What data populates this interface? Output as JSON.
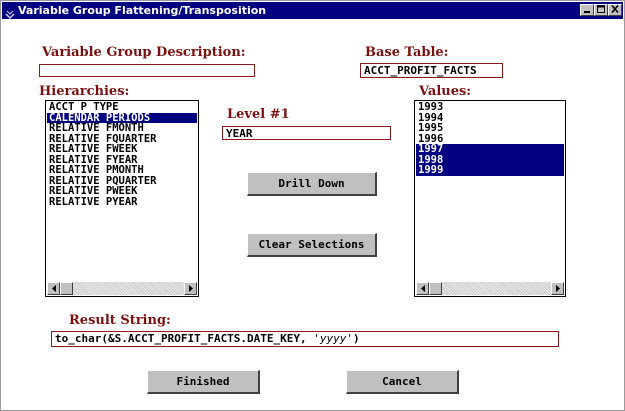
{
  "window": {
    "title": "Variable Group Flattening/Transposition",
    "controls": {
      "minimize": "_",
      "maximize": "□",
      "close": "×"
    }
  },
  "variable_group_description": {
    "label": "Variable Group Description:",
    "value": ""
  },
  "base_table": {
    "label": "Base Table:",
    "value": "ACCT_PROFIT_FACTS"
  },
  "hierarchies": {
    "label": "Hierarchies:",
    "items": [
      {
        "text": "ACCT P TYPE",
        "selected": false
      },
      {
        "text": "CALENDAR PERIODS",
        "selected": true
      },
      {
        "text": "RELATIVE FMONTH",
        "selected": false
      },
      {
        "text": "RELATIVE FQUARTER",
        "selected": false
      },
      {
        "text": "RELATIVE FWEEK",
        "selected": false
      },
      {
        "text": "RELATIVE FYEAR",
        "selected": false
      },
      {
        "text": "RELATIVE PMONTH",
        "selected": false
      },
      {
        "text": "RELATIVE PQUARTER",
        "selected": false
      },
      {
        "text": "RELATIVE PWEEK",
        "selected": false
      },
      {
        "text": "RELATIVE PYEAR",
        "selected": false
      }
    ]
  },
  "level": {
    "label": "Level #1",
    "value": "YEAR"
  },
  "buttons": {
    "drill_down": "Drill Down",
    "clear_selections": "Clear Selections",
    "finished": "Finished",
    "cancel": "Cancel"
  },
  "values": {
    "label": "Values:",
    "items": [
      {
        "text": "1993",
        "selected": false
      },
      {
        "text": "1994",
        "selected": false
      },
      {
        "text": "1995",
        "selected": false
      },
      {
        "text": "1996",
        "selected": false
      },
      {
        "text": "1997",
        "selected": true
      },
      {
        "text": "1998",
        "selected": true
      },
      {
        "text": "1999",
        "selected": true
      }
    ]
  },
  "result_string": {
    "label": "Result String:",
    "prefix": "to_char(&S.ACCT_PROFIT_FACTS.DATE_KEY, ",
    "quoted": "'yyyy'",
    "suffix": ")"
  },
  "colors": {
    "title_bar": "#000080",
    "label_text": "#7a1010",
    "field_border": "#8b1a1a",
    "selection": "#000080",
    "button_face": "#c0c0c0"
  },
  "icons": {
    "title": "system-menu-icon",
    "scroll_left": "arrow-left-icon",
    "scroll_right": "arrow-right-icon"
  }
}
